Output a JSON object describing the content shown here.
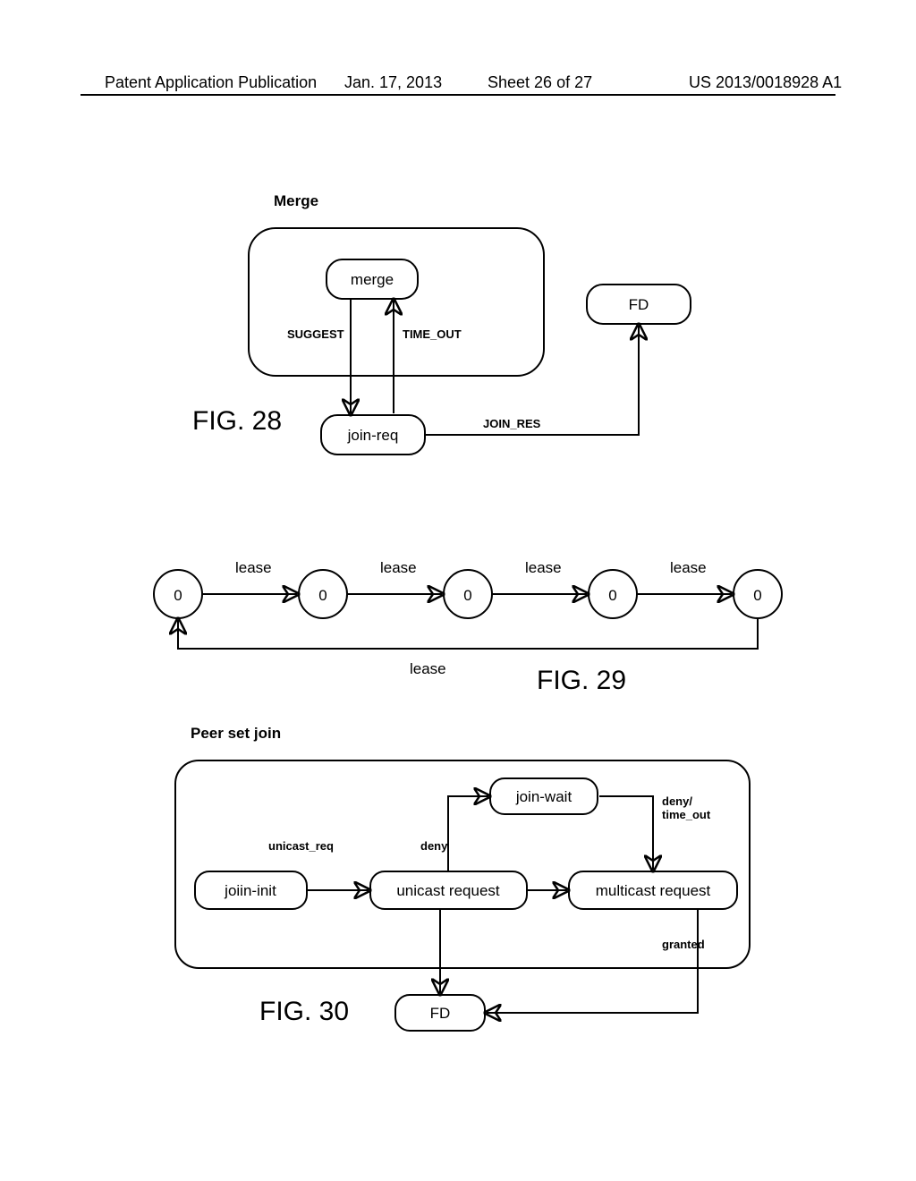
{
  "header": {
    "left": "Patent Application Publication",
    "date": "Jan. 17, 2013",
    "sheet": "Sheet 26 of 27",
    "pub": "US 2013/0018928 A1"
  },
  "fig28": {
    "title": "Merge",
    "label": "FIG. 28",
    "states": {
      "merge": "merge",
      "joinreq": "join-req",
      "fd": "FD"
    },
    "edges": {
      "suggest": "SUGGEST",
      "timeout": "TIME_OUT",
      "joinres": "JOIN_RES"
    }
  },
  "fig29": {
    "label": "FIG. 29",
    "node": "0",
    "edge": "lease",
    "loop": "lease"
  },
  "fig30": {
    "title": "Peer set join",
    "label": "FIG. 30",
    "states": {
      "joininit": "joiin-init",
      "unicast": "unicast request",
      "multicast": "multicast request",
      "joinwait": "join-wait",
      "fd": "FD"
    },
    "edges": {
      "unicastreq": "unicast_req",
      "deny": "deny",
      "denyto": "deny/\ntime_out",
      "granted": "granted"
    }
  },
  "chart_data": [
    {
      "type": "diagram",
      "name": "FIG. 28",
      "title": "Merge",
      "states": [
        "merge",
        "join-req",
        "FD"
      ],
      "transitions": [
        {
          "from": "merge",
          "to": "join-req",
          "label": "SUGGEST"
        },
        {
          "from": "join-req",
          "to": "merge",
          "label": "TIME_OUT"
        },
        {
          "from": "join-req",
          "to": "FD",
          "label": "JOIN_RES"
        }
      ]
    },
    {
      "type": "diagram",
      "name": "FIG. 29",
      "nodes": [
        "0",
        "0",
        "0",
        "0",
        "0"
      ],
      "edges": [
        {
          "from": 0,
          "to": 1,
          "label": "lease"
        },
        {
          "from": 1,
          "to": 2,
          "label": "lease"
        },
        {
          "from": 2,
          "to": 3,
          "label": "lease"
        },
        {
          "from": 3,
          "to": 4,
          "label": "lease"
        },
        {
          "from": 4,
          "to": 0,
          "label": "lease"
        }
      ]
    },
    {
      "type": "diagram",
      "name": "FIG. 30",
      "title": "Peer set join",
      "states": [
        "joiin-init",
        "unicast request",
        "multicast request",
        "join-wait",
        "FD"
      ],
      "transitions": [
        {
          "from": "joiin-init",
          "to": "unicast request",
          "label": "unicast_req"
        },
        {
          "from": "unicast request",
          "to": "join-wait",
          "label": "deny"
        },
        {
          "from": "join-wait",
          "to": "multicast request",
          "label": "deny/time_out"
        },
        {
          "from": "multicast request",
          "to": "FD",
          "label": "granted"
        },
        {
          "from": "unicast request",
          "to": "FD",
          "label": ""
        },
        {
          "from": "unicast request",
          "to": "multicast request",
          "label": ""
        }
      ]
    }
  ]
}
